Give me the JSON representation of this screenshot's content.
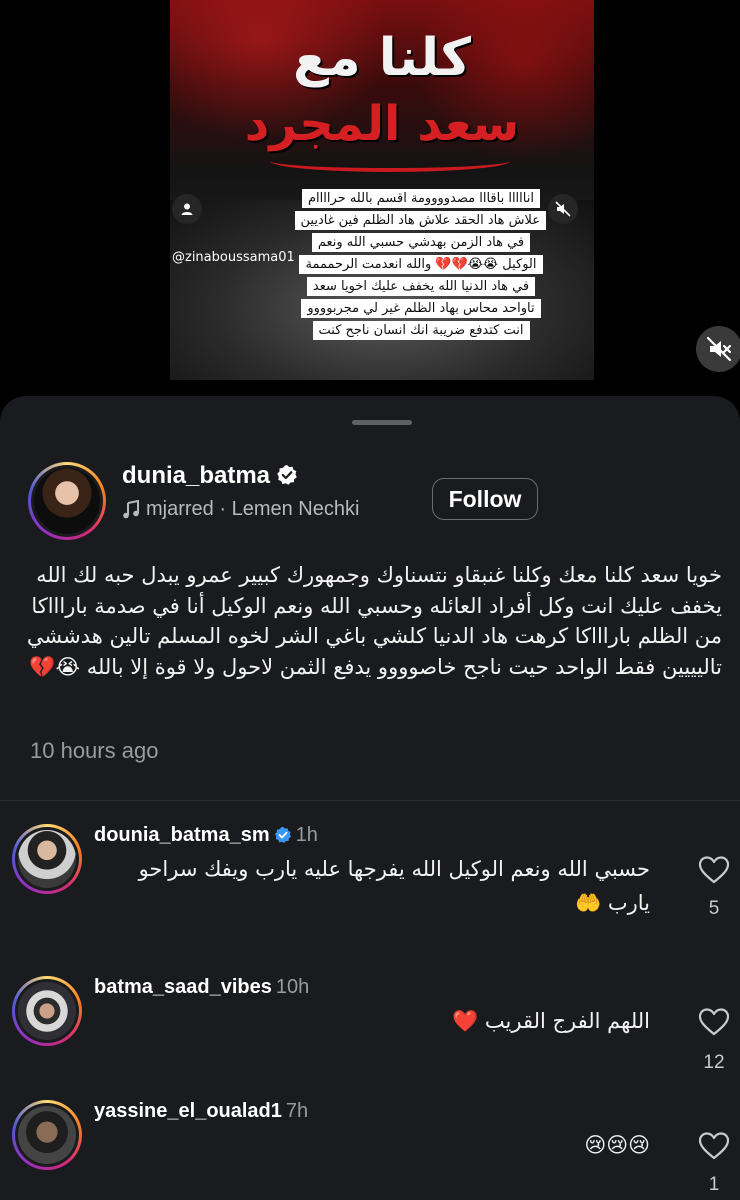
{
  "media": {
    "headline_line1": "كلنا مع",
    "headline_line2": "سعد المجرد",
    "caption": "انااااا باقااا مصدوووومة اقسم بالله حراااام علاش هاد الحقد علاش هاد الظلم فين غاديين في هاد الزمن بهدشي حسبي الله ونعم الوكيل 😭😭💔💔 والله انعدمت الرحمممة في هاد الدنيا الله يخفف عليك اخويا سعد تاواحد محاس بهاد الظلم غير لي مجربوووو انت كتدفع ضريبة انك انسان ناجح كنت",
    "tagged_user": "@zinaboussama01"
  },
  "post": {
    "username": "dunia_batma",
    "audio": "mjarred · Lemen Nechki",
    "follow_label": "Follow",
    "text": "خويا سعد كلنا معك وكلنا غنبقاو نتسناوك وجمهورك كبيير عمرو يبدل حبه لك الله يخفف عليك انت وكل أفراد العائله وحسبي الله ونعم الوكيل أنا في صدمة باراااكا من الظلم باراااكا كرهت هاد الدنيا كلشي باغي الشر لخوه المسلم تالين هدششي تاليييين فقط الواحد حيت ناجح خاصوووو يدفع الثمن لاحول ولا قوة إلا بالله 😭💔",
    "time_ago": "10 hours ago"
  },
  "comments": [
    {
      "username": "dounia_batma_sm",
      "time": "1h",
      "text": "حسبي الله ونعم الوكيل الله يفرجها عليه يارب ويفك سراحو يارب 🤲",
      "likes": "5"
    },
    {
      "username": "batma_saad_vibes",
      "time": "10h",
      "text": "اللهم الفرج القريب ❤️",
      "likes": "12"
    },
    {
      "username": "yassine_el_oualad1",
      "time": "7h",
      "text": "😢😢😢",
      "likes": "1"
    }
  ],
  "icons": {
    "accent_verified": "#ffffff",
    "heart": "heart-outline-icon",
    "mute": "speaker-muted-icon",
    "music": "music-note-icon"
  }
}
